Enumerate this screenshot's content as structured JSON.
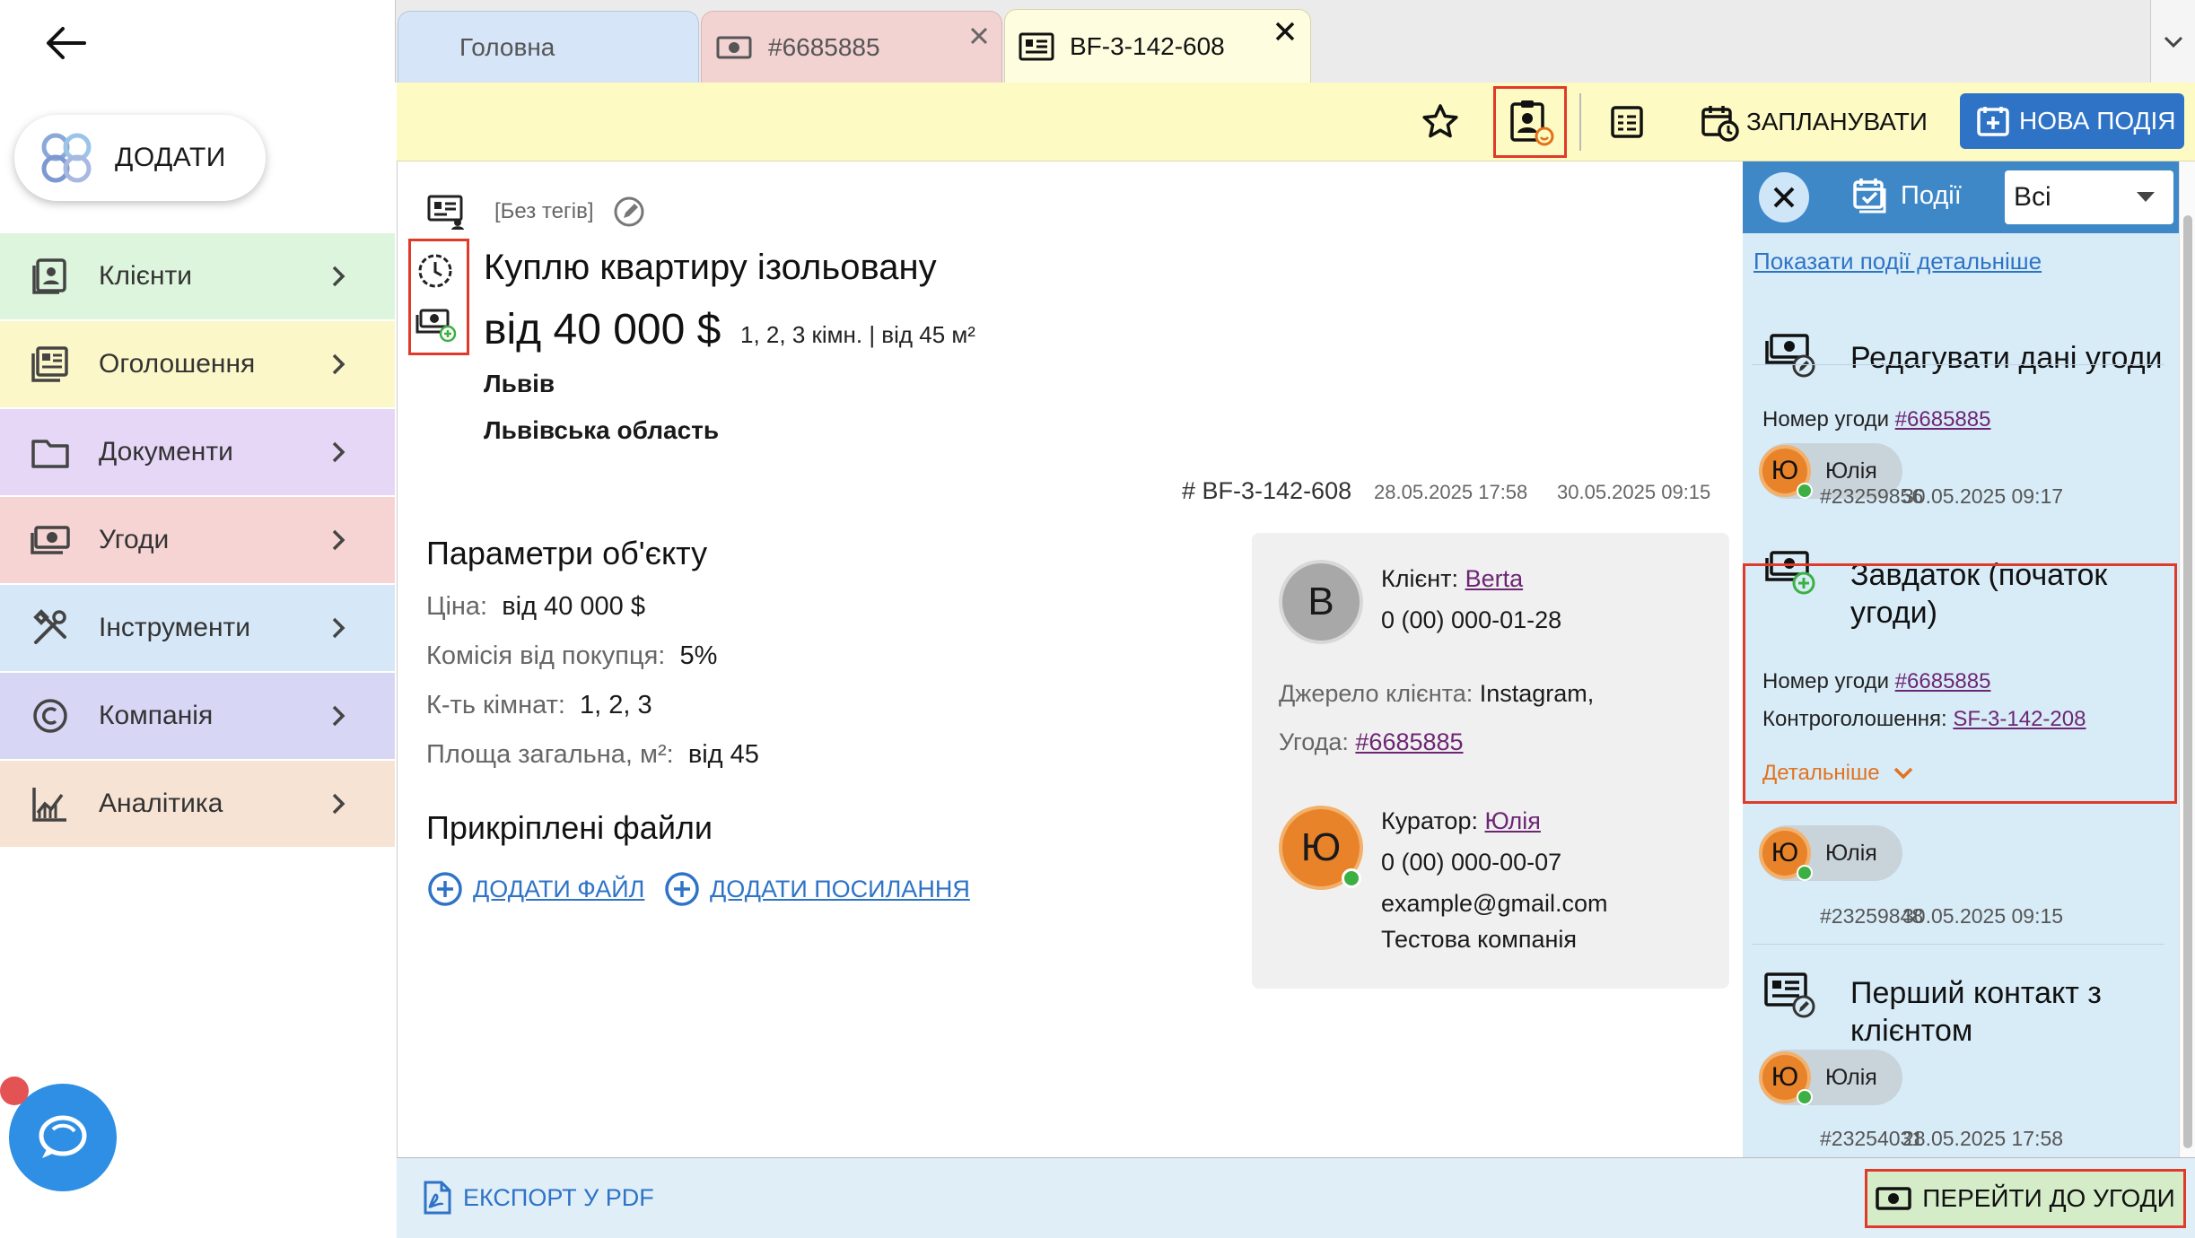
{
  "sidebar": {
    "add_label": "ДОДАТИ",
    "items": [
      {
        "label": "Клієнти",
        "color": "#dcf5dc"
      },
      {
        "label": "Оголошення",
        "color": "#fbf7c8"
      },
      {
        "label": "Документи",
        "color": "#e6d7f7"
      },
      {
        "label": "Угоди",
        "color": "#f7d4d4"
      },
      {
        "label": "Інструменти",
        "color": "#d6e7f7"
      },
      {
        "label": "Компанія",
        "color": "#d7d6f5"
      },
      {
        "label": "Аналітика",
        "color": "#f7e3d4"
      }
    ]
  },
  "tabs": [
    {
      "label": "Головна"
    },
    {
      "label": "#6685885"
    },
    {
      "label": "BF-3-142-608"
    }
  ],
  "toolbar": {
    "schedule_label": "ЗАПЛАНУВАТИ",
    "new_event_label": "НОВА ПОДІЯ"
  },
  "listing": {
    "tags": "[Без тегів]",
    "title": "Куплю квартиру ізольовану",
    "price": "від 40 000 $",
    "summary": "1, 2, 3 кімн. | від 45 м²",
    "city": "Львів",
    "region": "Львівська область",
    "id": "# BF-3-142-608",
    "created": "28.05.2025 17:58",
    "updated": "30.05.2025 09:15"
  },
  "params": {
    "heading": "Параметри об'єкту",
    "rows": [
      {
        "label": "Ціна:",
        "value": "від 40 000 $"
      },
      {
        "label": "Комісія від покупця:",
        "value": "5%"
      },
      {
        "label": "К-ть кімнат:",
        "value": "1, 2, 3"
      },
      {
        "label": "Площа загальна, м²:",
        "value": "від 45"
      }
    ]
  },
  "files": {
    "heading": "Прикріплені файли",
    "add_file": "ДОДАТИ ФАЙЛ",
    "add_link": "ДОДАТИ ПОСИЛАННЯ"
  },
  "client_card": {
    "client_initial": "B",
    "client_label": "Клієнт:",
    "client_name": "Berta",
    "client_phone": "0 (00) 000-01-28",
    "source_label": "Джерело клієнта:",
    "source_value": "Instagram,",
    "deal_label": "Угода:",
    "deal_value": "#6685885",
    "curator_initial": "Ю",
    "curator_label": "Куратор:",
    "curator_name": "Юлія",
    "curator_phone": "0 (00) 000-00-07",
    "curator_email": "example@gmail.com",
    "curator_company": "Тестова компанія"
  },
  "events": {
    "header_label": "Події",
    "filter_value": "Всі",
    "show_details": "Показати події детальніше",
    "items": [
      {
        "title": "Редагувати дані угоди",
        "line1_label": "Номер угоди",
        "line1_value": "#6685885",
        "user": "Юлія",
        "user_initial": "Ю",
        "id": "#23259856",
        "date": "30.05.2025 09:17"
      },
      {
        "title": "Завдаток (початок угоди)",
        "line1_label": "Номер угоди",
        "line1_value": "#6685885",
        "line2_label": "Контроголошення:",
        "line2_value": "SF-3-142-208",
        "more": "Детальніше",
        "user": "Юлія",
        "user_initial": "Ю",
        "id": "#23259848",
        "date": "30.05.2025 09:15"
      },
      {
        "title": "Перший контакт з клієнтом",
        "user": "Юлія",
        "user_initial": "Ю",
        "id": "#23254031",
        "date": "28.05.2025 17:58"
      }
    ]
  },
  "footer": {
    "export_label": "ЕКСПОРТ У PDF",
    "goto_deal_label": "ПЕРЕЙТИ ДО УГОДИ"
  }
}
